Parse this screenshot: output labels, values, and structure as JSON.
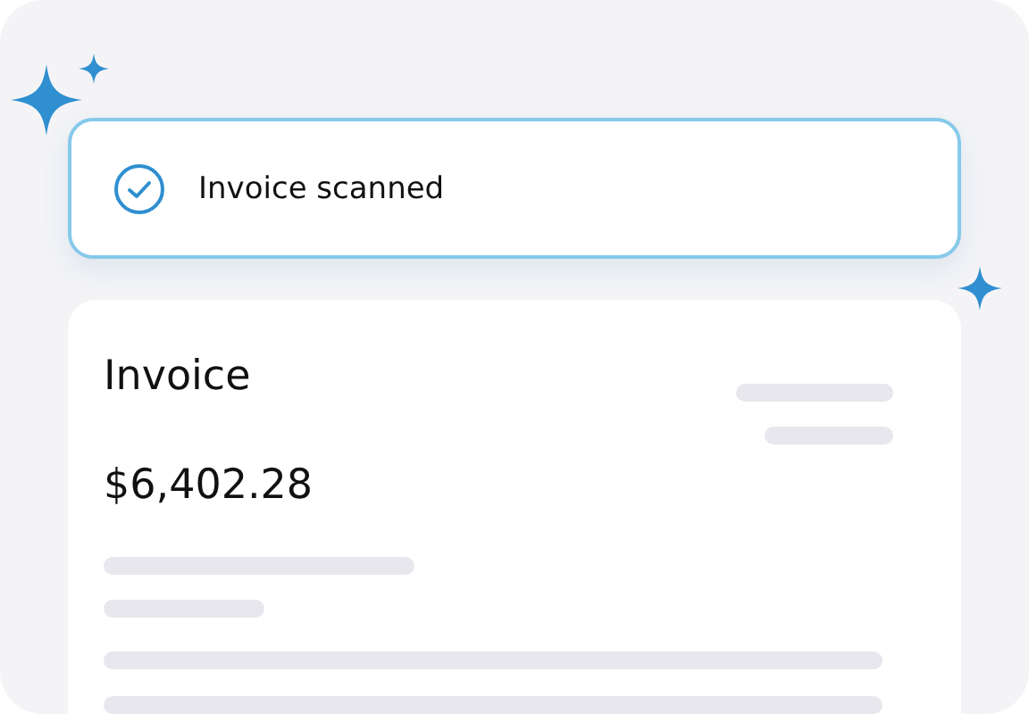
{
  "notification": {
    "message": "Invoice scanned"
  },
  "invoice": {
    "title": "Invoice",
    "amount": "$6,402.28"
  }
}
